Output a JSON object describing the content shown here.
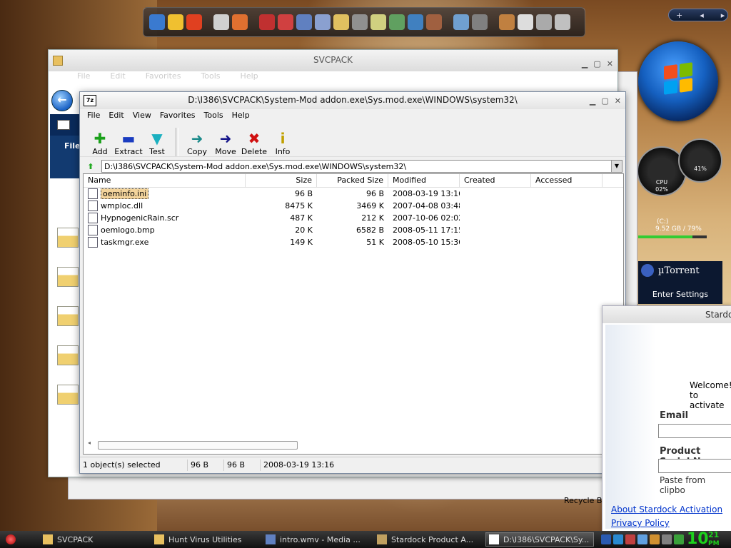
{
  "dock": {
    "icons": [
      "media-icon",
      "counter-icon",
      "flash-icon",
      "cd-icon",
      "paint-icon",
      "books-icon",
      "ie-icon",
      "network-icon",
      "clipboard-icon",
      "folder-icon",
      "wrench-icon",
      "notes-icon",
      "package-icon",
      "window-icon",
      "hammer-icon",
      "display-icon",
      "tools-icon",
      "paint2-icon",
      "power-icon",
      "sound-icon",
      "trash-icon"
    ]
  },
  "topright": {
    "plus": "+",
    "prev": "◂",
    "next": "▸"
  },
  "gauges": {
    "cpu_label": "CPU",
    "cpu_value": "02%",
    "mem_value": "41%"
  },
  "disk": {
    "label": "(C:)",
    "value": "9.52 GB / 79%"
  },
  "utorrent": {
    "title": "µTorrent",
    "action": "Enter Settings"
  },
  "svcpack_window": {
    "title": "SVCPACK",
    "menu": [
      "File",
      "Edit",
      "Favorites",
      "Tools",
      "Help"
    ],
    "file_label": "File"
  },
  "zip_window": {
    "title": "D:\\I386\\SVCPACK\\System-Mod addon.exe\\Sys.mod.exe\\WINDOWS\\system32\\",
    "logo": "7z",
    "menu": [
      "File",
      "Edit",
      "View",
      "Favorites",
      "Tools",
      "Help"
    ],
    "toolbar": [
      {
        "label": "Add",
        "icon": "add-icon",
        "glyph": "✚",
        "color": "#1aa01a"
      },
      {
        "label": "Extract",
        "icon": "extract-icon",
        "glyph": "▬",
        "color": "#1a3cc0"
      },
      {
        "label": "Test",
        "icon": "test-icon",
        "glyph": "▼",
        "color": "#1bb0c0"
      },
      {
        "label": "Copy",
        "icon": "copy-icon",
        "glyph": "➜",
        "color": "#1a8a8a"
      },
      {
        "label": "Move",
        "icon": "move-icon",
        "glyph": "➜",
        "color": "#14148a"
      },
      {
        "label": "Delete",
        "icon": "delete-icon",
        "glyph": "✖",
        "color": "#d01010"
      },
      {
        "label": "Info",
        "icon": "info-icon",
        "glyph": "i",
        "color": "#c0a000"
      }
    ],
    "address": "D:\\I386\\SVCPACK\\System-Mod addon.exe\\Sys.mod.exe\\WINDOWS\\system32\\",
    "columns": [
      "Name",
      "Size",
      "Packed Size",
      "Modified",
      "Created",
      "Accessed"
    ],
    "files": [
      {
        "name": "oeminfo.ini",
        "size": "96 B",
        "packed": "96 B",
        "modified": "2008-03-19 13:16",
        "created": "",
        "accessed": "",
        "selected": true
      },
      {
        "name": "wmploc.dll",
        "size": "8475 K",
        "packed": "3469 K",
        "modified": "2007-04-08 03:48",
        "created": "",
        "accessed": "",
        "selected": false
      },
      {
        "name": "HypnogenicRain.scr",
        "size": "487 K",
        "packed": "212 K",
        "modified": "2007-10-06 02:02",
        "created": "",
        "accessed": "",
        "selected": false
      },
      {
        "name": "oemlogo.bmp",
        "size": "20 K",
        "packed": "6582 B",
        "modified": "2008-05-11 17:15",
        "created": "",
        "accessed": "",
        "selected": false
      },
      {
        "name": "taskmgr.exe",
        "size": "149 K",
        "packed": "51 K",
        "modified": "2008-05-10 15:36",
        "created": "",
        "accessed": "",
        "selected": false
      }
    ],
    "status": {
      "selected": "1 object(s) selected",
      "size": "96 B",
      "packed": "96 B",
      "modified": "2008-03-19 13:16"
    }
  },
  "stardock": {
    "title": "Stardo",
    "welcome": "Welcome!",
    "activate": "to activate",
    "email_label": "Email",
    "serial_label": "Product Serial N",
    "paste_label": "Paste from clipbo",
    "link_about": "About Stardock Activation",
    "link_privacy": "Privacy Policy"
  },
  "desktop": {
    "recycle": "Recycle Bi"
  },
  "taskbar": {
    "tasks": [
      {
        "label": "SVCPACK",
        "icon": "folder-icon",
        "active": false
      },
      {
        "label": "Hunt Virus Utilities",
        "icon": "folder-icon",
        "active": false
      },
      {
        "label": "intro.wmv - Media ...",
        "icon": "media-icon",
        "active": false
      },
      {
        "label": "Stardock Product A...",
        "icon": "stardock-icon",
        "active": false
      },
      {
        "label": "D:\\I386\\SVCPACK\\Sy...",
        "icon": "7zip-icon",
        "active": true
      }
    ],
    "clock_hour": "10",
    "clock_min": "21",
    "clock_ampm": "PM"
  },
  "colors": {
    "accent": "#1560c0",
    "selection": "#f3d49c",
    "clock": "#1cd21c"
  }
}
